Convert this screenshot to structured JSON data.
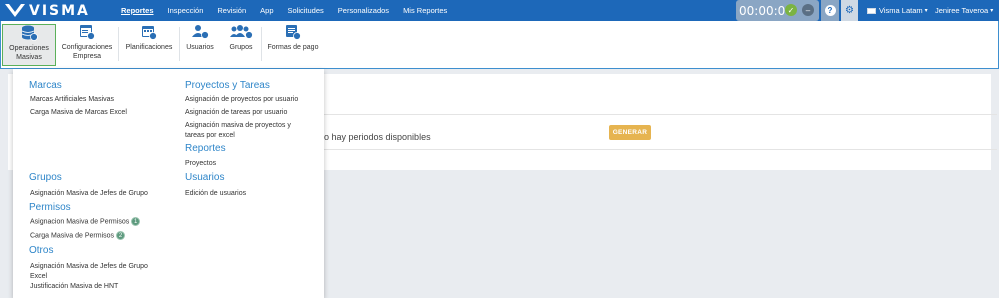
{
  "brand": {
    "name": "VISMA"
  },
  "topnav": {
    "items": [
      {
        "label": "Reportes",
        "active": true
      },
      {
        "label": "Inspección"
      },
      {
        "label": "Revisión"
      },
      {
        "label": "App"
      },
      {
        "label": "Solicitudes"
      },
      {
        "label": "Personalizados"
      },
      {
        "label": "Mis Reportes"
      }
    ],
    "timer": "00:00:00",
    "help": "?",
    "company": "Visma Latam",
    "user": "Jeniree Taveroa"
  },
  "toolbar": {
    "items": [
      {
        "line1": "Operaciones",
        "line2": "Masivas",
        "icon": "database-icon"
      },
      {
        "line1": "Configuraciones",
        "line2": "Empresa",
        "icon": "settings-window-icon"
      },
      {
        "line1": "Planificaciones",
        "line2": "",
        "icon": "calendar-icon"
      },
      {
        "line1": "Usuarios",
        "line2": "",
        "icon": "user-icon"
      },
      {
        "line1": "Grupos",
        "line2": "",
        "icon": "group-icon"
      },
      {
        "line1": "Formas de pago",
        "line2": "",
        "icon": "payment-icon"
      }
    ]
  },
  "menu": {
    "marcas": {
      "title": "Marcas",
      "items": [
        "Marcas Artificiales Masivas",
        "Carga Masiva de Marcas Excel"
      ]
    },
    "grupos": {
      "title": "Grupos",
      "items": [
        "Asignación Masiva de Jefes de Grupo"
      ]
    },
    "permisos": {
      "title": "Permisos",
      "items": [
        "Asignacion Masiva de Permisos",
        "Carga Masiva de Permisos"
      ],
      "badges": [
        "1",
        "2"
      ]
    },
    "otros": {
      "title": "Otros",
      "items": [
        "Asignación Masiva de Jefes de Grupo Excel",
        "Justificación Masiva de HNT"
      ]
    },
    "proyectos": {
      "title": "Proyectos y Tareas",
      "items": [
        "Asignación de proyectos por usuario",
        "Asignación de tareas por usuario",
        "Asignación masiva de proyectos y tareas por excel"
      ]
    },
    "reportes": {
      "title": "Reportes",
      "items": [
        "Proyectos"
      ]
    },
    "usuarios": {
      "title": "Usuarios",
      "items": [
        "Edición de usuarios"
      ]
    }
  },
  "main": {
    "message": "o hay periodos disponibles",
    "generate_label": "GENERAR"
  }
}
